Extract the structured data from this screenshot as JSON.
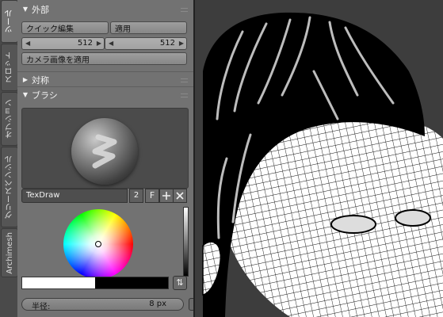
{
  "tabs": [
    {
      "label": "ツール"
    },
    {
      "label": "スロット"
    },
    {
      "label": "オプション"
    },
    {
      "label": "グリースペンシル"
    },
    {
      "label": "Archimesh"
    }
  ],
  "external": {
    "title": "外部",
    "quick_edit_label": "クイック編集",
    "apply_label": "適用",
    "width_value": "512",
    "height_value": "512",
    "apply_camera_label": "カメラ画像を適用"
  },
  "symmetry": {
    "title": "対称"
  },
  "brush": {
    "title": "ブラシ",
    "name": "TexDraw",
    "users": "2",
    "fake_user": "F",
    "add_icon": "plus-icon",
    "remove_icon": "close-icon",
    "primary_color": "#ffffff",
    "secondary_color": "#000000",
    "radius_label": "半径:",
    "radius_value": "8 px"
  },
  "viewport": {
    "background": "#3d3d3d",
    "mesh_color": "#ffffff",
    "wire_color": "#000000"
  }
}
